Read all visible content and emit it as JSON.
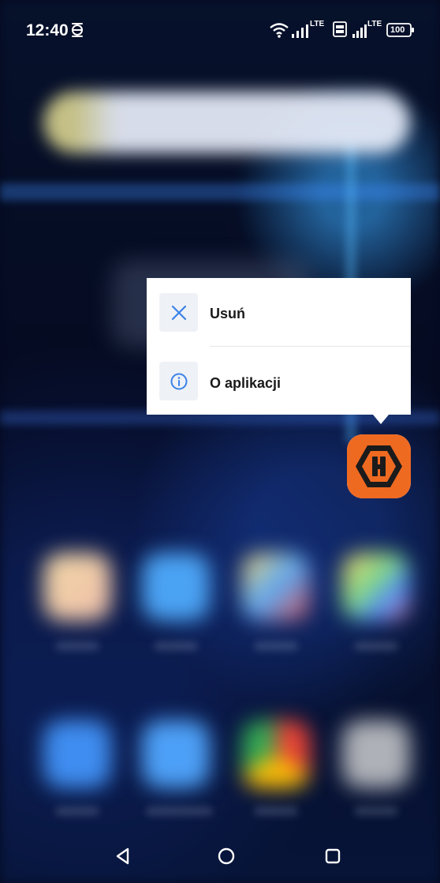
{
  "status_bar": {
    "time": "12:40",
    "lte_1": "LTE",
    "lte_2": "LTE",
    "battery": "100"
  },
  "menu": {
    "items": [
      {
        "label": "Usuń",
        "icon": "close-icon"
      },
      {
        "label": "O aplikacji",
        "icon": "info-icon"
      }
    ]
  },
  "selected_app": {
    "icon": "app-h-logo-icon",
    "letter": "H"
  },
  "colors": {
    "accent_blue": "#3b82e8",
    "app_orange": "#ef6a21",
    "app_dark": "#1b1b1b"
  },
  "nav": {
    "back": "back-icon",
    "home": "home-icon",
    "recents": "recents-icon"
  }
}
